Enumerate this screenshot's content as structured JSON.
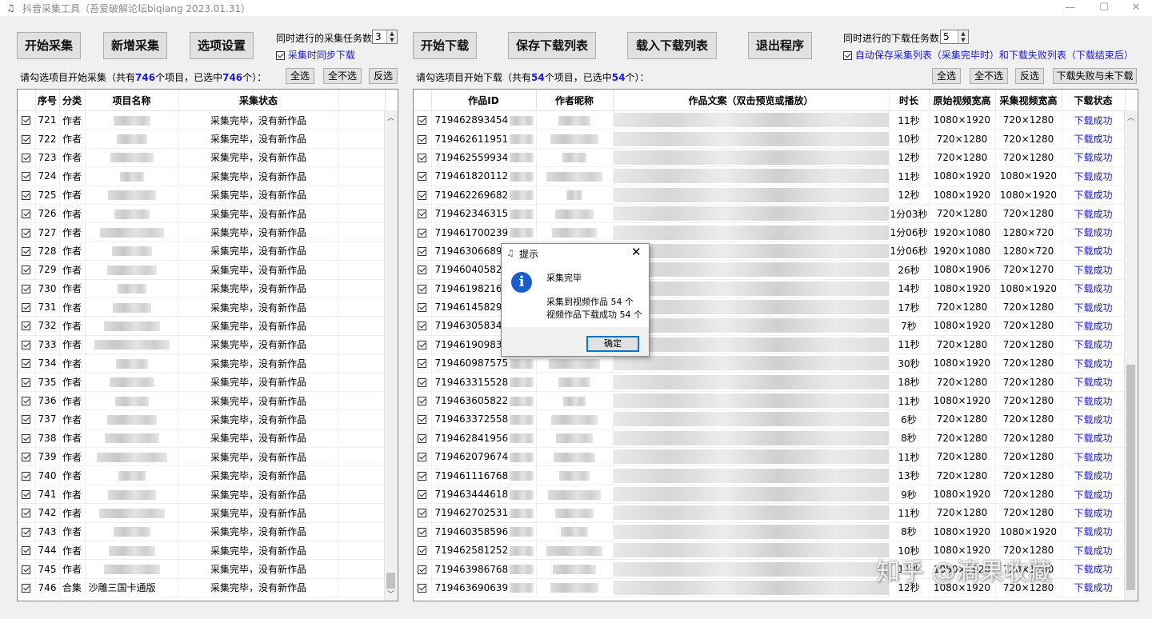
{
  "window": {
    "title": "抖音采集工具（吾爱破解论坛biqiang 2023.01.31）",
    "icon": "app-icon"
  },
  "toolbar_left": {
    "start_collect": "开始采集",
    "new_collect": "新增采集",
    "options": "选项设置",
    "concurrent_label": "同时进行的采集任务数",
    "concurrent_value": "3",
    "sync_download": "采集时同步下载"
  },
  "toolbar_right": {
    "start_download": "开始下载",
    "save_list": "保存下载列表",
    "load_list": "载入下载列表",
    "exit": "退出程序",
    "concurrent_label": "同时进行的下载任务数",
    "concurrent_value": "5",
    "auto_save": "自动保存采集列表（采集完毕时）和下载失败列表（下载结束后）"
  },
  "left_panel": {
    "info_prefix": "请勾选项目开始采集（共有",
    "total": "746",
    "info_mid": "个项目，已选中",
    "selected": "746",
    "info_suffix": "个）：",
    "select_all": "全选",
    "select_none": "全不选",
    "invert": "反选",
    "headers": [
      "序号",
      "分类",
      "项目名称",
      "采集状态"
    ],
    "rows": [
      {
        "no": "721",
        "cat": "作者",
        "name": "",
        "status": "采集完毕，没有新作品"
      },
      {
        "no": "722",
        "cat": "作者",
        "name": "",
        "status": "采集完毕，没有新作品"
      },
      {
        "no": "723",
        "cat": "作者",
        "name": "",
        "status": "采集完毕，没有新作品"
      },
      {
        "no": "724",
        "cat": "作者",
        "name": "",
        "status": "采集完毕，没有新作品"
      },
      {
        "no": "725",
        "cat": "作者",
        "name": "",
        "status": "采集完毕，没有新作品"
      },
      {
        "no": "726",
        "cat": "作者",
        "name": "",
        "status": "采集完毕，没有新作品"
      },
      {
        "no": "727",
        "cat": "作者",
        "name": "",
        "status": "采集完毕，没有新作品"
      },
      {
        "no": "728",
        "cat": "作者",
        "name": "",
        "status": "采集完毕，没有新作品"
      },
      {
        "no": "729",
        "cat": "作者",
        "name": "",
        "status": "采集完毕，没有新作品"
      },
      {
        "no": "730",
        "cat": "作者",
        "name": "",
        "status": "采集完毕，没有新作品"
      },
      {
        "no": "731",
        "cat": "作者",
        "name": "",
        "status": "采集完毕，没有新作品"
      },
      {
        "no": "732",
        "cat": "作者",
        "name": "",
        "status": "采集完毕，没有新作品"
      },
      {
        "no": "733",
        "cat": "作者",
        "name": "",
        "status": "采集完毕，没有新作品"
      },
      {
        "no": "734",
        "cat": "作者",
        "name": "",
        "status": "采集完毕，没有新作品"
      },
      {
        "no": "735",
        "cat": "作者",
        "name": "",
        "status": "采集完毕，没有新作品"
      },
      {
        "no": "736",
        "cat": "作者",
        "name": "",
        "status": "采集完毕，没有新作品"
      },
      {
        "no": "737",
        "cat": "作者",
        "name": "",
        "status": "采集完毕，没有新作品"
      },
      {
        "no": "738",
        "cat": "作者",
        "name": "",
        "status": "采集完毕，没有新作品"
      },
      {
        "no": "739",
        "cat": "作者",
        "name": "",
        "status": "采集完毕，没有新作品"
      },
      {
        "no": "740",
        "cat": "作者",
        "name": "",
        "status": "采集完毕，没有新作品"
      },
      {
        "no": "741",
        "cat": "作者",
        "name": "",
        "status": "采集完毕，没有新作品"
      },
      {
        "no": "742",
        "cat": "作者",
        "name": "",
        "status": "采集完毕，没有新作品"
      },
      {
        "no": "743",
        "cat": "作者",
        "name": "",
        "status": "采集完毕，没有新作品"
      },
      {
        "no": "744",
        "cat": "作者",
        "name": "",
        "status": "采集完毕，没有新作品"
      },
      {
        "no": "745",
        "cat": "作者",
        "name": "",
        "status": "采集完毕，没有新作品"
      },
      {
        "no": "746",
        "cat": "合集",
        "name": "沙雕三国卡通版",
        "status": "采集完毕，没有新作品"
      }
    ]
  },
  "right_panel": {
    "info_prefix": "请勾选项目开始下载（共有",
    "total": "54",
    "info_mid": "个项目，已选中",
    "selected": "54",
    "info_suffix": "个）：",
    "select_all": "全选",
    "select_none": "全不选",
    "invert": "反选",
    "fail_button": "下载失败与未下载",
    "headers": [
      "作品ID",
      "作者昵称",
      "作品文案（双击预览或播放）",
      "时长",
      "原始视频宽高",
      "采集视频宽高",
      "下载状态"
    ],
    "rows": [
      {
        "id": "719462893454",
        "dur": "11秒",
        "orig": "1080×1920",
        "coll": "720×1280",
        "status": "下载成功"
      },
      {
        "id": "719462611951",
        "dur": "10秒",
        "orig": "720×1280",
        "coll": "720×1280",
        "status": "下载成功"
      },
      {
        "id": "719462559934",
        "dur": "12秒",
        "orig": "720×1280",
        "coll": "720×1280",
        "status": "下载成功"
      },
      {
        "id": "719461820112",
        "dur": "11秒",
        "orig": "1080×1920",
        "coll": "1080×1920",
        "status": "下载成功"
      },
      {
        "id": "719462269682",
        "dur": "12秒",
        "orig": "1080×1920",
        "coll": "1080×1920",
        "status": "下载成功"
      },
      {
        "id": "719462346315",
        "dur": "1分03秒",
        "orig": "720×1280",
        "coll": "720×1280",
        "status": "下载成功"
      },
      {
        "id": "719461700239",
        "dur": "1分06秒",
        "orig": "1920×1080",
        "coll": "1280×720",
        "status": "下载成功"
      },
      {
        "id": "719463066893",
        "dur": "1分06秒",
        "orig": "1920×1080",
        "coll": "1280×720",
        "status": "下载成功"
      },
      {
        "id": "719460405820",
        "dur": "26秒",
        "orig": "1080×1906",
        "coll": "720×1270",
        "status": "下载成功"
      },
      {
        "id": "719461982168",
        "dur": "14秒",
        "orig": "1080×1920",
        "coll": "1080×1920",
        "status": "下载成功"
      },
      {
        "id": "719461458292",
        "dur": "17秒",
        "orig": "720×1280",
        "coll": "720×1280",
        "status": "下载成功"
      },
      {
        "id": "719463058347",
        "dur": "7秒",
        "orig": "1080×1920",
        "coll": "720×1280",
        "status": "下载成功"
      },
      {
        "id": "719461909833",
        "dur": "11秒",
        "orig": "720×1280",
        "coll": "720×1280",
        "status": "下载成功"
      },
      {
        "id": "719460987575",
        "dur": "30秒",
        "orig": "1080×1920",
        "coll": "720×1280",
        "status": "下载成功"
      },
      {
        "id": "719463315528",
        "dur": "18秒",
        "orig": "720×1280",
        "coll": "720×1280",
        "status": "下载成功"
      },
      {
        "id": "719463605822",
        "dur": "11秒",
        "orig": "1080×1920",
        "coll": "720×1280",
        "status": "下载成功"
      },
      {
        "id": "719463372558",
        "dur": "6秒",
        "orig": "720×1280",
        "coll": "720×1280",
        "status": "下载成功"
      },
      {
        "id": "719462841956",
        "dur": "8秒",
        "orig": "720×1280",
        "coll": "720×1280",
        "status": "下载成功"
      },
      {
        "id": "719462079674",
        "dur": "11秒",
        "orig": "720×1280",
        "coll": "720×1280",
        "status": "下载成功"
      },
      {
        "id": "719461116768",
        "dur": "13秒",
        "orig": "720×1280",
        "coll": "720×1280",
        "status": "下载成功"
      },
      {
        "id": "719463444618",
        "dur": "9秒",
        "orig": "1080×1920",
        "coll": "720×1280",
        "status": "下载成功"
      },
      {
        "id": "719462702531",
        "dur": "11秒",
        "orig": "720×1280",
        "coll": "720×1280",
        "status": "下载成功"
      },
      {
        "id": "719460358596",
        "dur": "8秒",
        "orig": "1080×1920",
        "coll": "1080×1920",
        "status": "下载成功"
      },
      {
        "id": "719462581252",
        "dur": "10秒",
        "orig": "1080×1920",
        "coll": "720×1280",
        "status": "下载成功"
      },
      {
        "id": "719463986768",
        "dur": "11秒",
        "orig": "1080×1920",
        "coll": "720×1280",
        "status": "下载成功"
      },
      {
        "id": "719463690639",
        "dur": "12秒",
        "orig": "1080×1920",
        "coll": "720×1280",
        "status": "下载成功"
      }
    ]
  },
  "dialog": {
    "title": "提示",
    "heading": "采集完毕",
    "line1": "采集到视频作品 54 个",
    "line2": "视频作品下载成功 54 个",
    "ok": "确定"
  },
  "watermark": "知乎 @滴果收藏"
}
